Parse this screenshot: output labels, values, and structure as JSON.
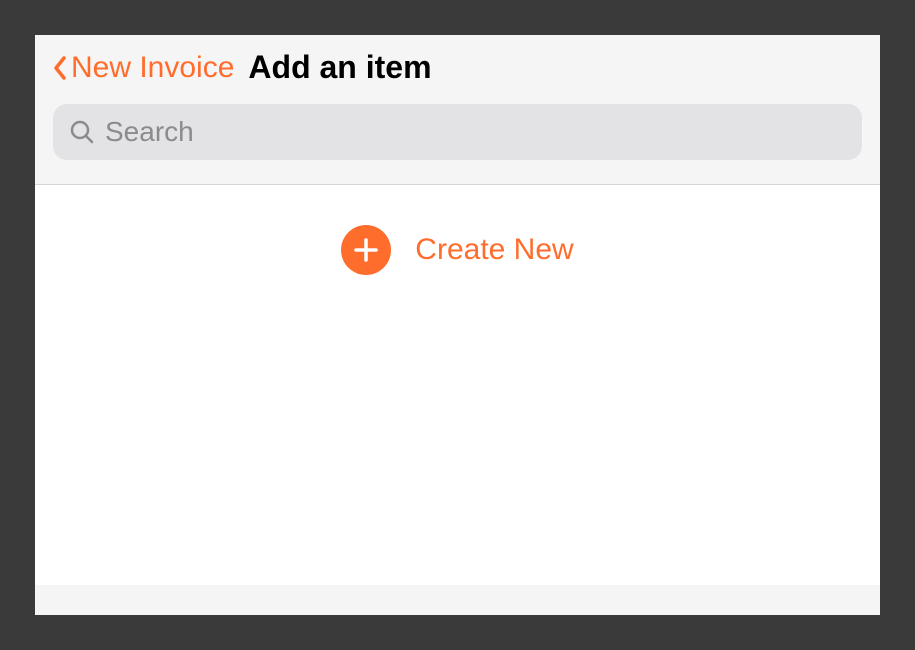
{
  "colors": {
    "accent": "#ff6d2d",
    "search_bg": "#e3e3e6",
    "placeholder": "#8b8b8f"
  },
  "header": {
    "back_label": "New Invoice",
    "title": "Add an item"
  },
  "search": {
    "placeholder": "Search",
    "value": ""
  },
  "actions": {
    "create_new_label": "Create New"
  }
}
